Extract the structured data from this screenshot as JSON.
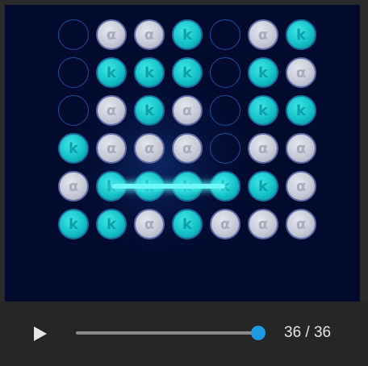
{
  "board": {
    "rows": [
      [
        "empty",
        "silver",
        "silver",
        "teal",
        "empty",
        "silver",
        "teal"
      ],
      [
        "empty",
        "teal",
        "teal",
        "teal",
        "empty",
        "teal",
        "silver"
      ],
      [
        "empty",
        "silver",
        "teal",
        "silver",
        "empty",
        "teal",
        "teal"
      ],
      [
        "teal",
        "silver",
        "silver",
        "silver",
        "empty",
        "silver",
        "silver"
      ],
      [
        "silver",
        "teal",
        "teal",
        "teal",
        "teal",
        "teal",
        "silver"
      ],
      [
        "teal",
        "teal",
        "silver",
        "teal",
        "silver",
        "silver",
        "silver"
      ]
    ],
    "winning_line": {
      "row": 4,
      "from_col": 1,
      "to_col": 4
    },
    "piece_glyphs": {
      "silver": "α",
      "teal": "k"
    }
  },
  "colors": {
    "board_background": "#020b2e",
    "teal_piece": "#14c2c8",
    "silver_piece": "#c7c9d6",
    "empty_outline": "#1d4f9c",
    "win_line": "#6ff6f6",
    "slider_thumb": "#1e9be0"
  },
  "controls": {
    "play_icon": "play-icon",
    "current_move": 36,
    "total_moves": 36,
    "counter_text": "36 / 36"
  }
}
